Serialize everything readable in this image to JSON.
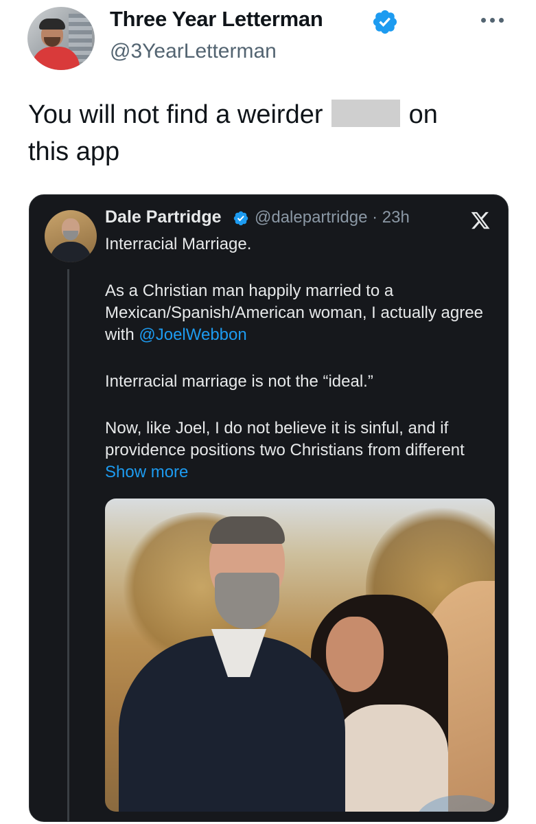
{
  "tweet": {
    "display_name": "Three Year Letterman",
    "handle": "@3YearLetterman",
    "text_before": "You will not find a weirder ",
    "text_after": " on",
    "text_line2": "this app"
  },
  "quoted": {
    "display_name": "Dale Partridge",
    "handle_time": "@dalepartridge · 23h",
    "line1": "Interracial Marriage.",
    "para2_text": "As a Christian man happily married to a Mexican/Spanish/American woman, I actually agree with ",
    "mention": "@JoelWebbon",
    "para3": "Interracial marriage is not the “ideal.”",
    "para4_text": "Now, like Joel, I do not believe it is sinful, and if providence positions two Christians from different ",
    "show_more": "Show more"
  },
  "colors": {
    "verified": "#1d9bf0",
    "card_bg": "#16181c",
    "link": "#1d9bf0"
  },
  "icons": [
    "verified-badge-icon",
    "more-icon",
    "x-logo-icon"
  ]
}
